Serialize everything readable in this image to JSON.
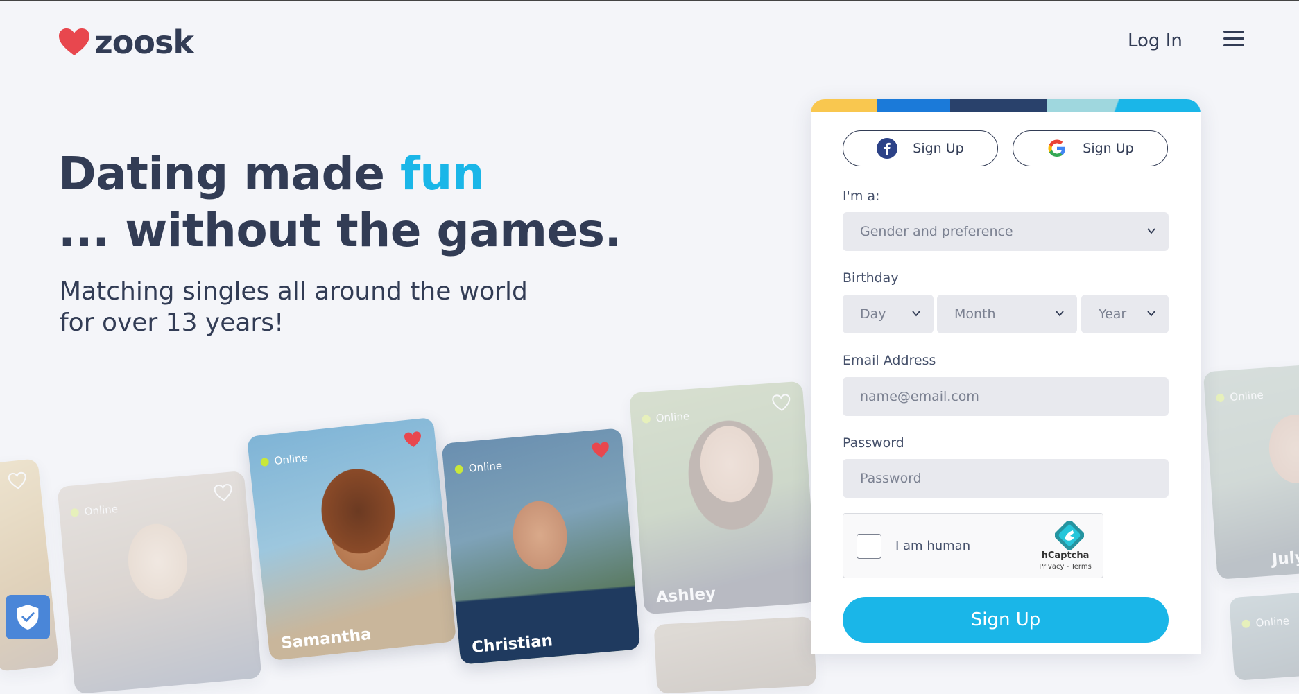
{
  "header": {
    "logo_text": "zoosk",
    "login_label": "Log In"
  },
  "hero": {
    "title_part1": "Dating made ",
    "title_accent": "fun",
    "title_line2": "... without the games.",
    "subtitle": "Matching singles all around the world for over 13 years!"
  },
  "cards": [
    {
      "name": "Samantha",
      "online": "Online"
    },
    {
      "name": "Christian",
      "online": "Online"
    },
    {
      "name": "Ashley",
      "online": "Online"
    },
    {
      "name": "July",
      "online": "Online"
    },
    {
      "online": "Online"
    },
    {
      "online": "Online"
    }
  ],
  "signup": {
    "facebook_label": "Sign Up",
    "google_label": "Sign Up",
    "im_a_label": "I'm a:",
    "gender_placeholder": "Gender and preference",
    "birthday_label": "Birthday",
    "day": "Day",
    "month": "Month",
    "year": "Year",
    "email_label": "Email Address",
    "email_placeholder": "name@email.com",
    "password_label": "Password",
    "password_placeholder": "Password",
    "captcha_text": "I am human",
    "captcha_brand": "hCaptcha",
    "captcha_terms": "Privacy - Terms",
    "submit_label": "Sign Up"
  },
  "colors": {
    "accent": "#1ab6e8",
    "text": "#323c55",
    "heart": "#e8474e",
    "stripe": [
      "#f9c74f",
      "#1b7ad9",
      "#29416b",
      "#9fd7de",
      "#1ab6e8"
    ]
  }
}
